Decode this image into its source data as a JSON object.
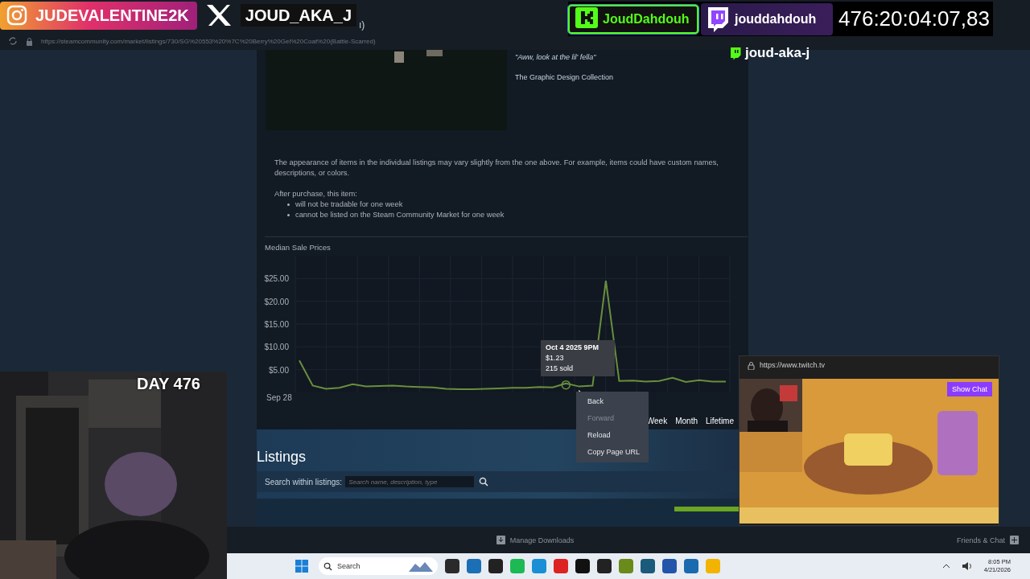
{
  "overlay": {
    "instagram": "JUDEVALENTINE2K",
    "x_handle": "JOUD_AKA_J",
    "tab_fragment": "ı)",
    "kick": "JoudDahdouh",
    "twitch": "jouddahdouh",
    "timer": "476:20:04:07,83",
    "twitch_tag": "joud-aka-j",
    "day": "DAY 476"
  },
  "browser": {
    "url": "https://steamcommunity.com/market/listings/730/SG%20553%20%7C%20Berry%20Gel%20Coat%20(Battle-Scarred)"
  },
  "item": {
    "quote": "\"Aww, look at the lil' fella\"",
    "collection": "The Graphic Design Collection"
  },
  "notice": {
    "text": "The appearance of items in the individual listings may vary slightly from the one above. For example, items could have custom names, descriptions, or colors.",
    "after": "After purchase, this item:",
    "bullets": [
      "will not be tradable for one week",
      "cannot be listed on the Steam Community Market for one week"
    ]
  },
  "price_history": {
    "title": "Median Sale Prices",
    "x_start_label": "Sep 28",
    "chart_data": {
      "type": "line",
      "grid": true,
      "ylim": [
        0,
        30
      ],
      "yticks": [
        {
          "value": 5,
          "label": "$5.00"
        },
        {
          "value": 10,
          "label": "$10.00"
        },
        {
          "value": 15,
          "label": "$15.00"
        },
        {
          "value": 20,
          "label": "$20.00"
        },
        {
          "value": 25,
          "label": "$25.00"
        }
      ],
      "series": [
        {
          "color": "#688f3e",
          "values": [
            7,
            1.5,
            0.8,
            1,
            1.8,
            1.3,
            1.4,
            1.5,
            1.3,
            1.2,
            1.1,
            0.8,
            0.7,
            0.7,
            0.8,
            0.9,
            1,
            1,
            1.2,
            1.1,
            2,
            1.3,
            1.5,
            24.5,
            2.5,
            2.6,
            2.4,
            2.5,
            3.2,
            2.3,
            2.7,
            2.4,
            2.4
          ]
        }
      ]
    },
    "tooltip": {
      "date": "Oct 4 2025 9PM",
      "price": "$1.23",
      "sold": "215 sold"
    },
    "ranges": [
      "Week",
      "Month",
      "Lifetime"
    ]
  },
  "listings": {
    "title": "Listings",
    "search_label": "Search within listings:",
    "search_placeholder": "Search name, description, type"
  },
  "context_menu": [
    {
      "label": "Back",
      "disabled": false
    },
    {
      "label": "Forward",
      "disabled": true
    },
    {
      "label": "Reload",
      "disabled": false
    },
    {
      "label": "Copy Page URL",
      "disabled": false
    }
  ],
  "pip": {
    "url": "https://www.twitch.tv",
    "button": "Show Chat"
  },
  "steam_bar": {
    "downloads": "Manage Downloads",
    "friends": "Friends & Chat"
  },
  "taskbar": {
    "search": "Search",
    "time": "8:05 PM",
    "date": "4/21/2026"
  }
}
